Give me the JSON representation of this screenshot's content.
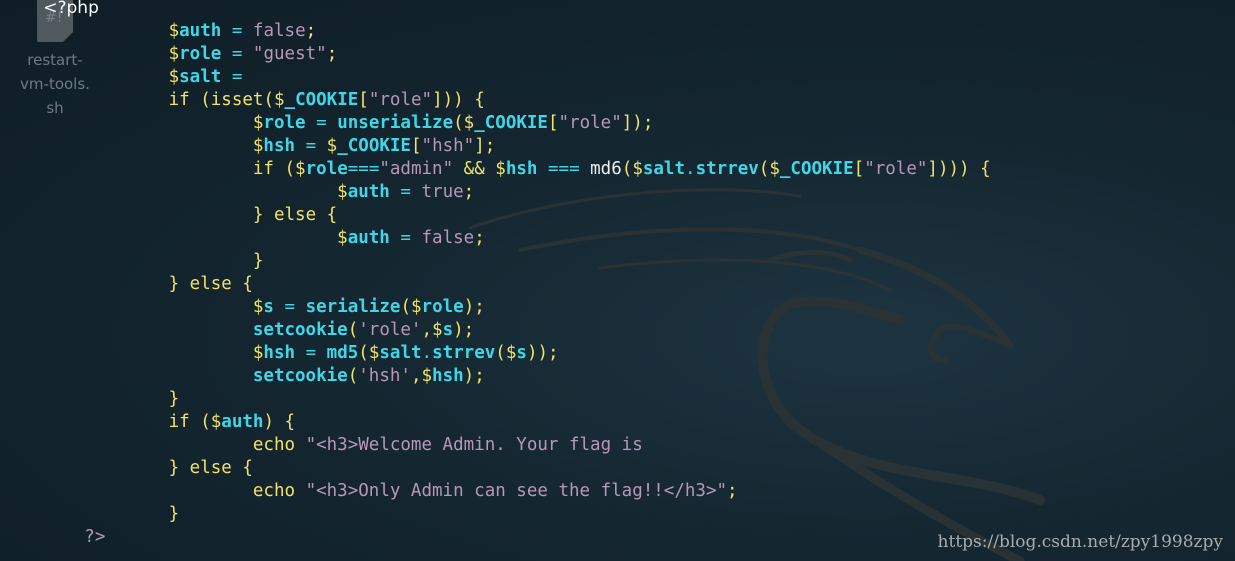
{
  "desktop_icon": {
    "glyph": "#!",
    "label_lines": [
      "restart-",
      "vm-tools.",
      "sh"
    ]
  },
  "code": {
    "open_tag": "<?php",
    "close_tag": "?>",
    "lines": [
      "$auth = false;",
      "$role = \"guest\";",
      "$salt =",
      "if (isset($_COOKIE[\"role\"])) {",
      "$role = unserialize($_COOKIE[\"role\"]);",
      "$hsh = $_COOKIE[\"hsh\"];",
      "if ($role===\"admin\" && $hsh === md6($salt.strrev($_COOKIE[\"role\"]))) {",
      "$auth = true;",
      "} else {",
      "$auth = false;",
      "}",
      "} else {",
      "$s = serialize($role);",
      "setcookie('role',$s);",
      "$hsh = md5($salt.strrev($s));",
      "setcookie('hsh',$hsh);",
      "}",
      "if ($auth) {",
      "echo \"<h3>Welcome Admin. Your flag is",
      "} else {",
      "echo \"<h3>Only Admin can see the flag!!</h3>\";",
      "}"
    ]
  },
  "watermark": "https://blog.csdn.net/zpy1998zpy",
  "colors": {
    "background": "#142630",
    "keyword": "#f0e36a",
    "variable": "#3fd7e8",
    "string": "#b897b9",
    "text": "#ffffff"
  },
  "icons": [
    "script-file-icon",
    "kali-dragon-logo"
  ]
}
